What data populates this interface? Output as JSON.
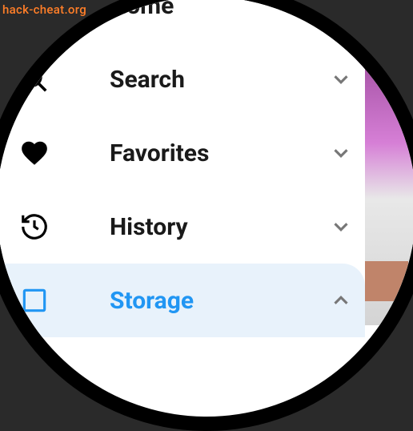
{
  "watermark": "hack-cheat.org",
  "menu": {
    "items": [
      {
        "label": "Home",
        "icon": "",
        "expandable": false,
        "selected": false
      },
      {
        "label": "Search",
        "icon": "search",
        "expandable": true,
        "expanded": false,
        "selected": false
      },
      {
        "label": "Favorites",
        "icon": "heart",
        "expandable": true,
        "expanded": false,
        "selected": false
      },
      {
        "label": "History",
        "icon": "history",
        "expandable": true,
        "expanded": false,
        "selected": false
      },
      {
        "label": "Storage",
        "icon": "storage",
        "expandable": true,
        "expanded": true,
        "selected": true
      }
    ]
  }
}
